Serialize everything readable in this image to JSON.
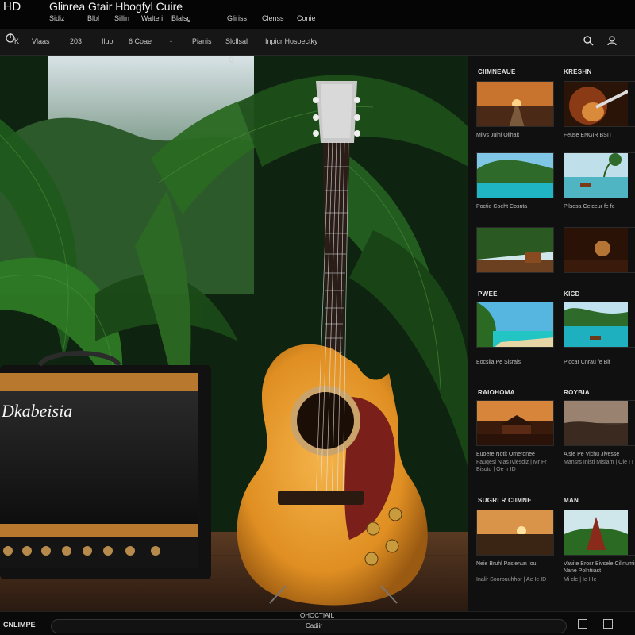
{
  "header": {
    "brand": "HD",
    "title": "Glinrea Gtair Hbogfyl Cuire",
    "menu": [
      "Sidiz",
      "Blbl",
      "Sillin",
      "Walte i",
      "Blalsg",
      "Gliriss",
      "Clenss",
      "Conie"
    ]
  },
  "nav": {
    "items": [
      "K",
      "Vlaas",
      "203",
      "Iluo",
      "6 Coae",
      "-",
      "Pianis",
      "Slcllsal",
      "Inpicr Hosoectky"
    ]
  },
  "hero": {
    "marker": "Q",
    "amp_brand": "Dkabeisia"
  },
  "sidebar": {
    "sections": [
      {
        "head_left": "CIIMNEAUE",
        "head_right": "KRESHN",
        "items": [
          {
            "caption": "Mlivs  Julhi  Olihait",
            "meta": ""
          },
          {
            "caption": "Feuse  ENGIR  BSIT",
            "meta": ""
          },
          {
            "caption": "Poctie  Coeht  Cosnta",
            "meta": ""
          },
          {
            "caption": "Pilsesa  Cetceur  fe  fe",
            "meta": ""
          },
          {
            "caption": "",
            "meta": ""
          },
          {
            "caption": "",
            "meta": ""
          }
        ]
      },
      {
        "head_left": "PWEE",
        "head_right": "KICD",
        "items": [
          {
            "caption": "Eocsiia  Pe  Sisrais",
            "meta": ""
          },
          {
            "caption": "Plocar  Cnrau  fe  Bif",
            "meta": ""
          }
        ]
      },
      {
        "head_left": "RAIOHOMA",
        "head_right": "ROYBIA",
        "items": [
          {
            "caption": "Euoere  Notit  Omeronee",
            "meta": "Fauqesi  Nlas  Iviesdiz  |  Mr  Fr  Bisoto  |  Oe  Ir  ID"
          },
          {
            "caption": "Alsie  Pe  Vichu  Jivesse",
            "meta": "Mansrs  Inisti  Misiam  |  Oie  I  I"
          }
        ]
      },
      {
        "head_left": "SUGRLR  CIIMNE",
        "head_right": "MAN",
        "items": [
          {
            "caption": "Neie  Bruhl  Paslenun  Iou",
            "meta": "Inalir  Soorbuuhhor  |  Ae  Ie  ID"
          },
          {
            "caption": "Vauite  Brosr  Bivsele  Cilinumist  Nane  Polntiiast",
            "meta": "Mi  cle  |  Ie  I  Ie"
          }
        ]
      }
    ]
  },
  "footer": {
    "left": "CNLIMPE",
    "center_label": "OHOCTIAIL",
    "field_label": "Cadiir"
  },
  "colors": {
    "background": "#0b0b0b",
    "guitar_body": "#e59a2c",
    "pickguard": "#7a1f1a",
    "amp_tolex": "#1a1a1a",
    "amp_wood": "#b8792e",
    "foliage": "#1f5a1c"
  }
}
